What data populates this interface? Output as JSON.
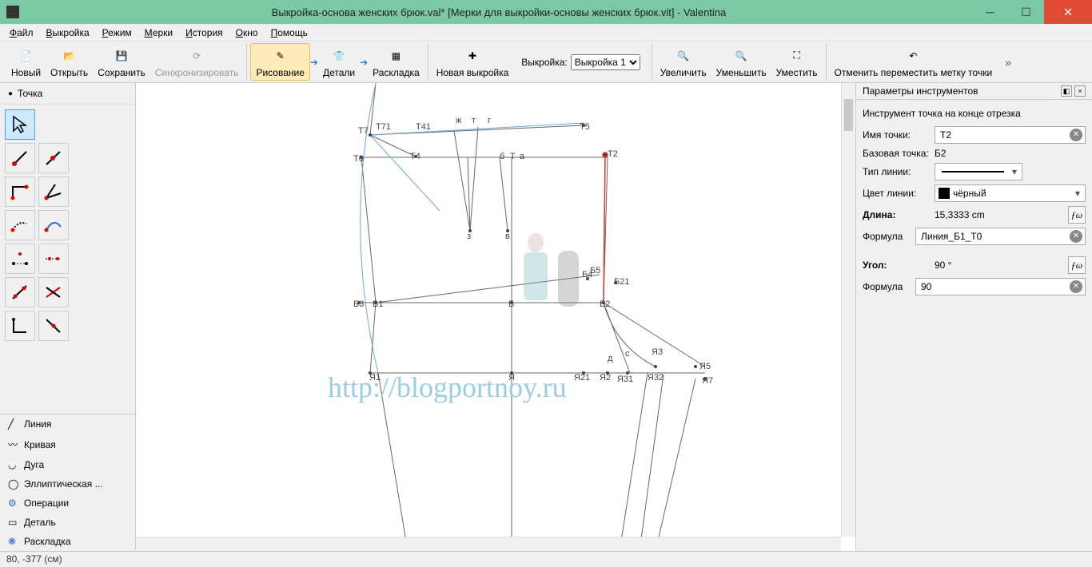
{
  "title": "Выкройка-основа женских брюк.val* [Мерки для выкройки-основы женских брюк.vit] - Valentina",
  "menus": [
    "Файл",
    "Выкройка",
    "Режим",
    "Мерки",
    "История",
    "Окно",
    "Помощь"
  ],
  "toolbar": {
    "new": "Новый",
    "open": "Открыть",
    "save": "Сохранить",
    "sync": "Синхронизировать",
    "draw": "Рисование",
    "details": "Детали",
    "layout": "Раскладка",
    "newpattern": "Новая выкройка",
    "pattern_label": "Выкройка:",
    "pattern_value": "Выкройка 1",
    "zoomin": "Увеличить",
    "zoomout": "Уменьшить",
    "fit": "Уместить",
    "undo_move_point": "Отменить переместить метку точки"
  },
  "left": {
    "active_cat": "Точка",
    "cats": [
      "Линия",
      "Кривая",
      "Дуга",
      "Эллиптическая ...",
      "Операции",
      "Деталь",
      "Раскладка"
    ]
  },
  "labels": {
    "T7": "Т7",
    "T71": "Т71",
    "T41": "Т41",
    "zh": "ж",
    "tt": "т",
    "gg": "г",
    "T5": "Т5",
    "T0": "Т0",
    "T4": "Т4",
    "b": "б",
    "T": "Т",
    "a": "а",
    "T2": "Т2",
    "z": "з",
    "v": "в",
    "B3": "Б3",
    "B1": "Б1",
    "B": "Б",
    "B4": "Б4",
    "B5": "Б5",
    "B2": "Б2",
    "B21": "Б21",
    "Ya1": "Я1",
    "Ya": "Я",
    "Ya21": "Я21",
    "Ya2": "Я2",
    "Ya31": "Я31",
    "Ya3": "Я3",
    "Ya32": "Я32",
    "Ya5": "Я5",
    "Ya7": "Я7",
    "d": "д",
    "c": "с"
  },
  "watermark": "http://blogportnoy.ru",
  "panel": {
    "title": "Параметры инструментов",
    "subtitle": "Инструмент точка на конце отрезка",
    "name_label": "Имя точки:",
    "name_value": "Т2",
    "base_label": "Базовая точка:",
    "base_value": "Б2",
    "linetype_label": "Тип линии:",
    "linecolor_label": "Цвет линии:",
    "linecolor_value": "чёрный",
    "length_label": "Длина:",
    "length_value": "15,3333 cm",
    "formula_label": "Формула",
    "formula_len_value": "Линия_Б1_Т0",
    "angle_label": "Угол:",
    "angle_value": "90 °",
    "formula_ang_value": "90"
  },
  "status": "80, -377 (см)"
}
